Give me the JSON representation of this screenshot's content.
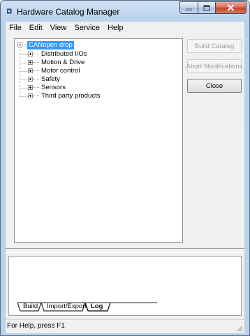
{
  "window": {
    "title": "Hardware Catalog Manager"
  },
  "menu": [
    "File",
    "Edit",
    "View",
    "Service",
    "Help"
  ],
  "tree": {
    "root": {
      "label": "CANopen drop",
      "expanded": true,
      "selected": true
    },
    "children": [
      {
        "label": "Distributed I/Os"
      },
      {
        "label": "Motion & Drive"
      },
      {
        "label": "Motor control"
      },
      {
        "label": "Safety"
      },
      {
        "label": "Sensors"
      },
      {
        "label": "Third party products"
      }
    ]
  },
  "buttons": {
    "build_catalog": {
      "label": "Build Catalog",
      "enabled": false
    },
    "abort_modifications": {
      "label": "Abort Modifications",
      "enabled": false
    },
    "close": {
      "label": "Close",
      "enabled": true
    }
  },
  "output_tabs": [
    {
      "label": "Build",
      "active": false
    },
    {
      "label": "Import/Export",
      "active": false
    },
    {
      "label": "Log",
      "active": true
    }
  ],
  "status": {
    "text": "For Help, press F1"
  },
  "colors": {
    "selection": "#3399ff",
    "title_gradient_top": "#cfe0f3",
    "face": "#f0f0f0"
  }
}
